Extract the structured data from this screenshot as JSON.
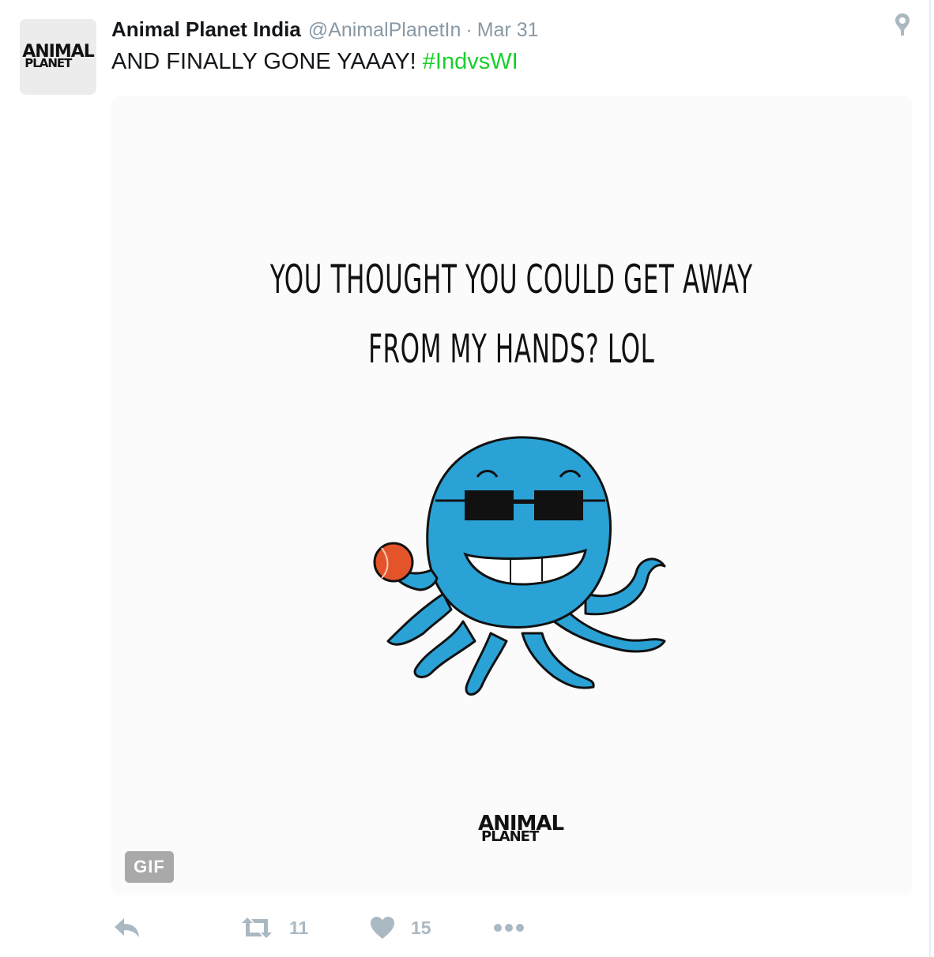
{
  "tweet": {
    "author_name": "Animal Planet India",
    "handle": "@AnimalPlanetIn",
    "separator": "·",
    "date": "Mar 31",
    "text": "AND FINALLY GONE YAAAY!",
    "hashtag": "#IndvsWI"
  },
  "avatar": {
    "logo_line1": "ANIMAL",
    "logo_line2": "PLANET"
  },
  "media": {
    "caption_line1": "YOU THOUGHT YOU COULD GET AWAY",
    "caption_line2": "FROM MY HANDS? LOL",
    "logo_line1": "ANIMAL",
    "logo_line2": "PLANET",
    "badge": "GIF"
  },
  "actions": {
    "retweet_count": "11",
    "like_count": "15"
  },
  "icons": [
    "pin-icon",
    "reply-icon",
    "retweet-icon",
    "heart-icon",
    "more-icon"
  ],
  "colors": {
    "hashtag": "#19cf2d",
    "secondary_text": "#8899a6",
    "action_icons": "#aab8c2",
    "octopus": "#2aa2d6",
    "ball": "#e4542a"
  }
}
